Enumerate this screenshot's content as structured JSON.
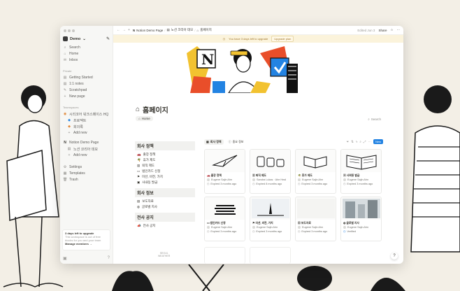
{
  "sidebar": {
    "workspace": "Demo",
    "items": [
      {
        "icon": "⌕",
        "label": "Search"
      },
      {
        "icon": "⌂",
        "label": "Home"
      },
      {
        "icon": "✉",
        "label": "Inbox"
      }
    ],
    "private_label": "Private",
    "private_items": [
      {
        "icon": "▤",
        "label": "Getting Started"
      },
      {
        "icon": "▤",
        "label": "1:1 notes"
      },
      {
        "icon": "✎",
        "label": "Scratchpad"
      },
      {
        "icon": "+",
        "label": "New page"
      }
    ],
    "teamspaces_label": "Teamspaces",
    "team_items": [
      {
        "icon": "◉",
        "label": "시리코어 워크스페이스 HQ"
      },
      {
        "icon": "◆",
        "label": "프로젝트"
      },
      {
        "icon": "◆",
        "label": "회의록"
      },
      {
        "icon": "+",
        "label": "Add new"
      }
    ],
    "demo_items": [
      {
        "icon": "N",
        "label": "Notion Demo Page"
      },
      {
        "icon": "▤",
        "label": "노션 코리아 데모"
      },
      {
        "icon": "+",
        "label": "Add new"
      }
    ],
    "settings_items": [
      {
        "icon": "⚙",
        "label": "Settings"
      },
      {
        "icon": "▦",
        "label": "Templates"
      },
      {
        "icon": "🗑",
        "label": "Trash"
      }
    ],
    "upgrade": {
      "title": "3 days left to upgrade",
      "desc1": "This workspace is out of free",
      "desc2": "blocks for you and your team",
      "link": "Manage members →"
    }
  },
  "topbar": {
    "crumbs": [
      "Notion Demo Page",
      "노션 코리아 데모",
      "홈페이지"
    ],
    "edited": "Edited Jun 3",
    "share": "Share"
  },
  "banner": {
    "text": "You have 3 days left to upgrade",
    "button": "Upgrade plan"
  },
  "page": {
    "title": "홈페이지",
    "home_tab": "Home",
    "search": "Search"
  },
  "policy": {
    "sections": [
      {
        "title": "회사 정책",
        "items": [
          "출장 정책",
          "휴가 제도",
          "퇴직 제도",
          "법인카드 신청",
          "미션, 비전, 가치",
          "사내동 발급"
        ]
      },
      {
        "title": "회사 정보",
        "items": [
          "보도자료",
          "글로벌 지사"
        ]
      },
      {
        "title": "전사 공지",
        "items": [
          "전사 공지"
        ]
      }
    ]
  },
  "database": {
    "tabs": [
      "회사 정책",
      "중요 정보"
    ],
    "new_label": "New",
    "cards": [
      {
        "title": "출장 정책",
        "person": "Eugene Sajin Ahn",
        "status": "Expired 3 months ago"
      },
      {
        "title": "퇴직 제도",
        "person": "Sandra Lukas  ·  Ahe Heal",
        "status": "Expired 8 months ago"
      },
      {
        "title": "휴가 제도",
        "person": "Eugene Sajin Ahn",
        "status": "Expired 3 months ago"
      },
      {
        "title": "사회동 발급",
        "person": "Eugene Sajin Ahn",
        "status": "Expired 3 months ago"
      },
      {
        "title": "법인카드 신청",
        "person": "Eugene Sajin Ahn",
        "status": "Expired 3 months ago"
      },
      {
        "title": "미션, 비전, 가치",
        "person": "Eugene Sajin Ahn",
        "status": "Expired 3 months ago"
      },
      {
        "title": "보도자료",
        "person": "Eugene Sajin Ahn",
        "status": "Expired 3 months ago"
      },
      {
        "title": "글로벌 지사",
        "person": "Eugene Sajin Ahn",
        "status": "Verified"
      }
    ]
  },
  "footer": {
    "line1": "SEOUL",
    "line2": "WEATHER"
  }
}
